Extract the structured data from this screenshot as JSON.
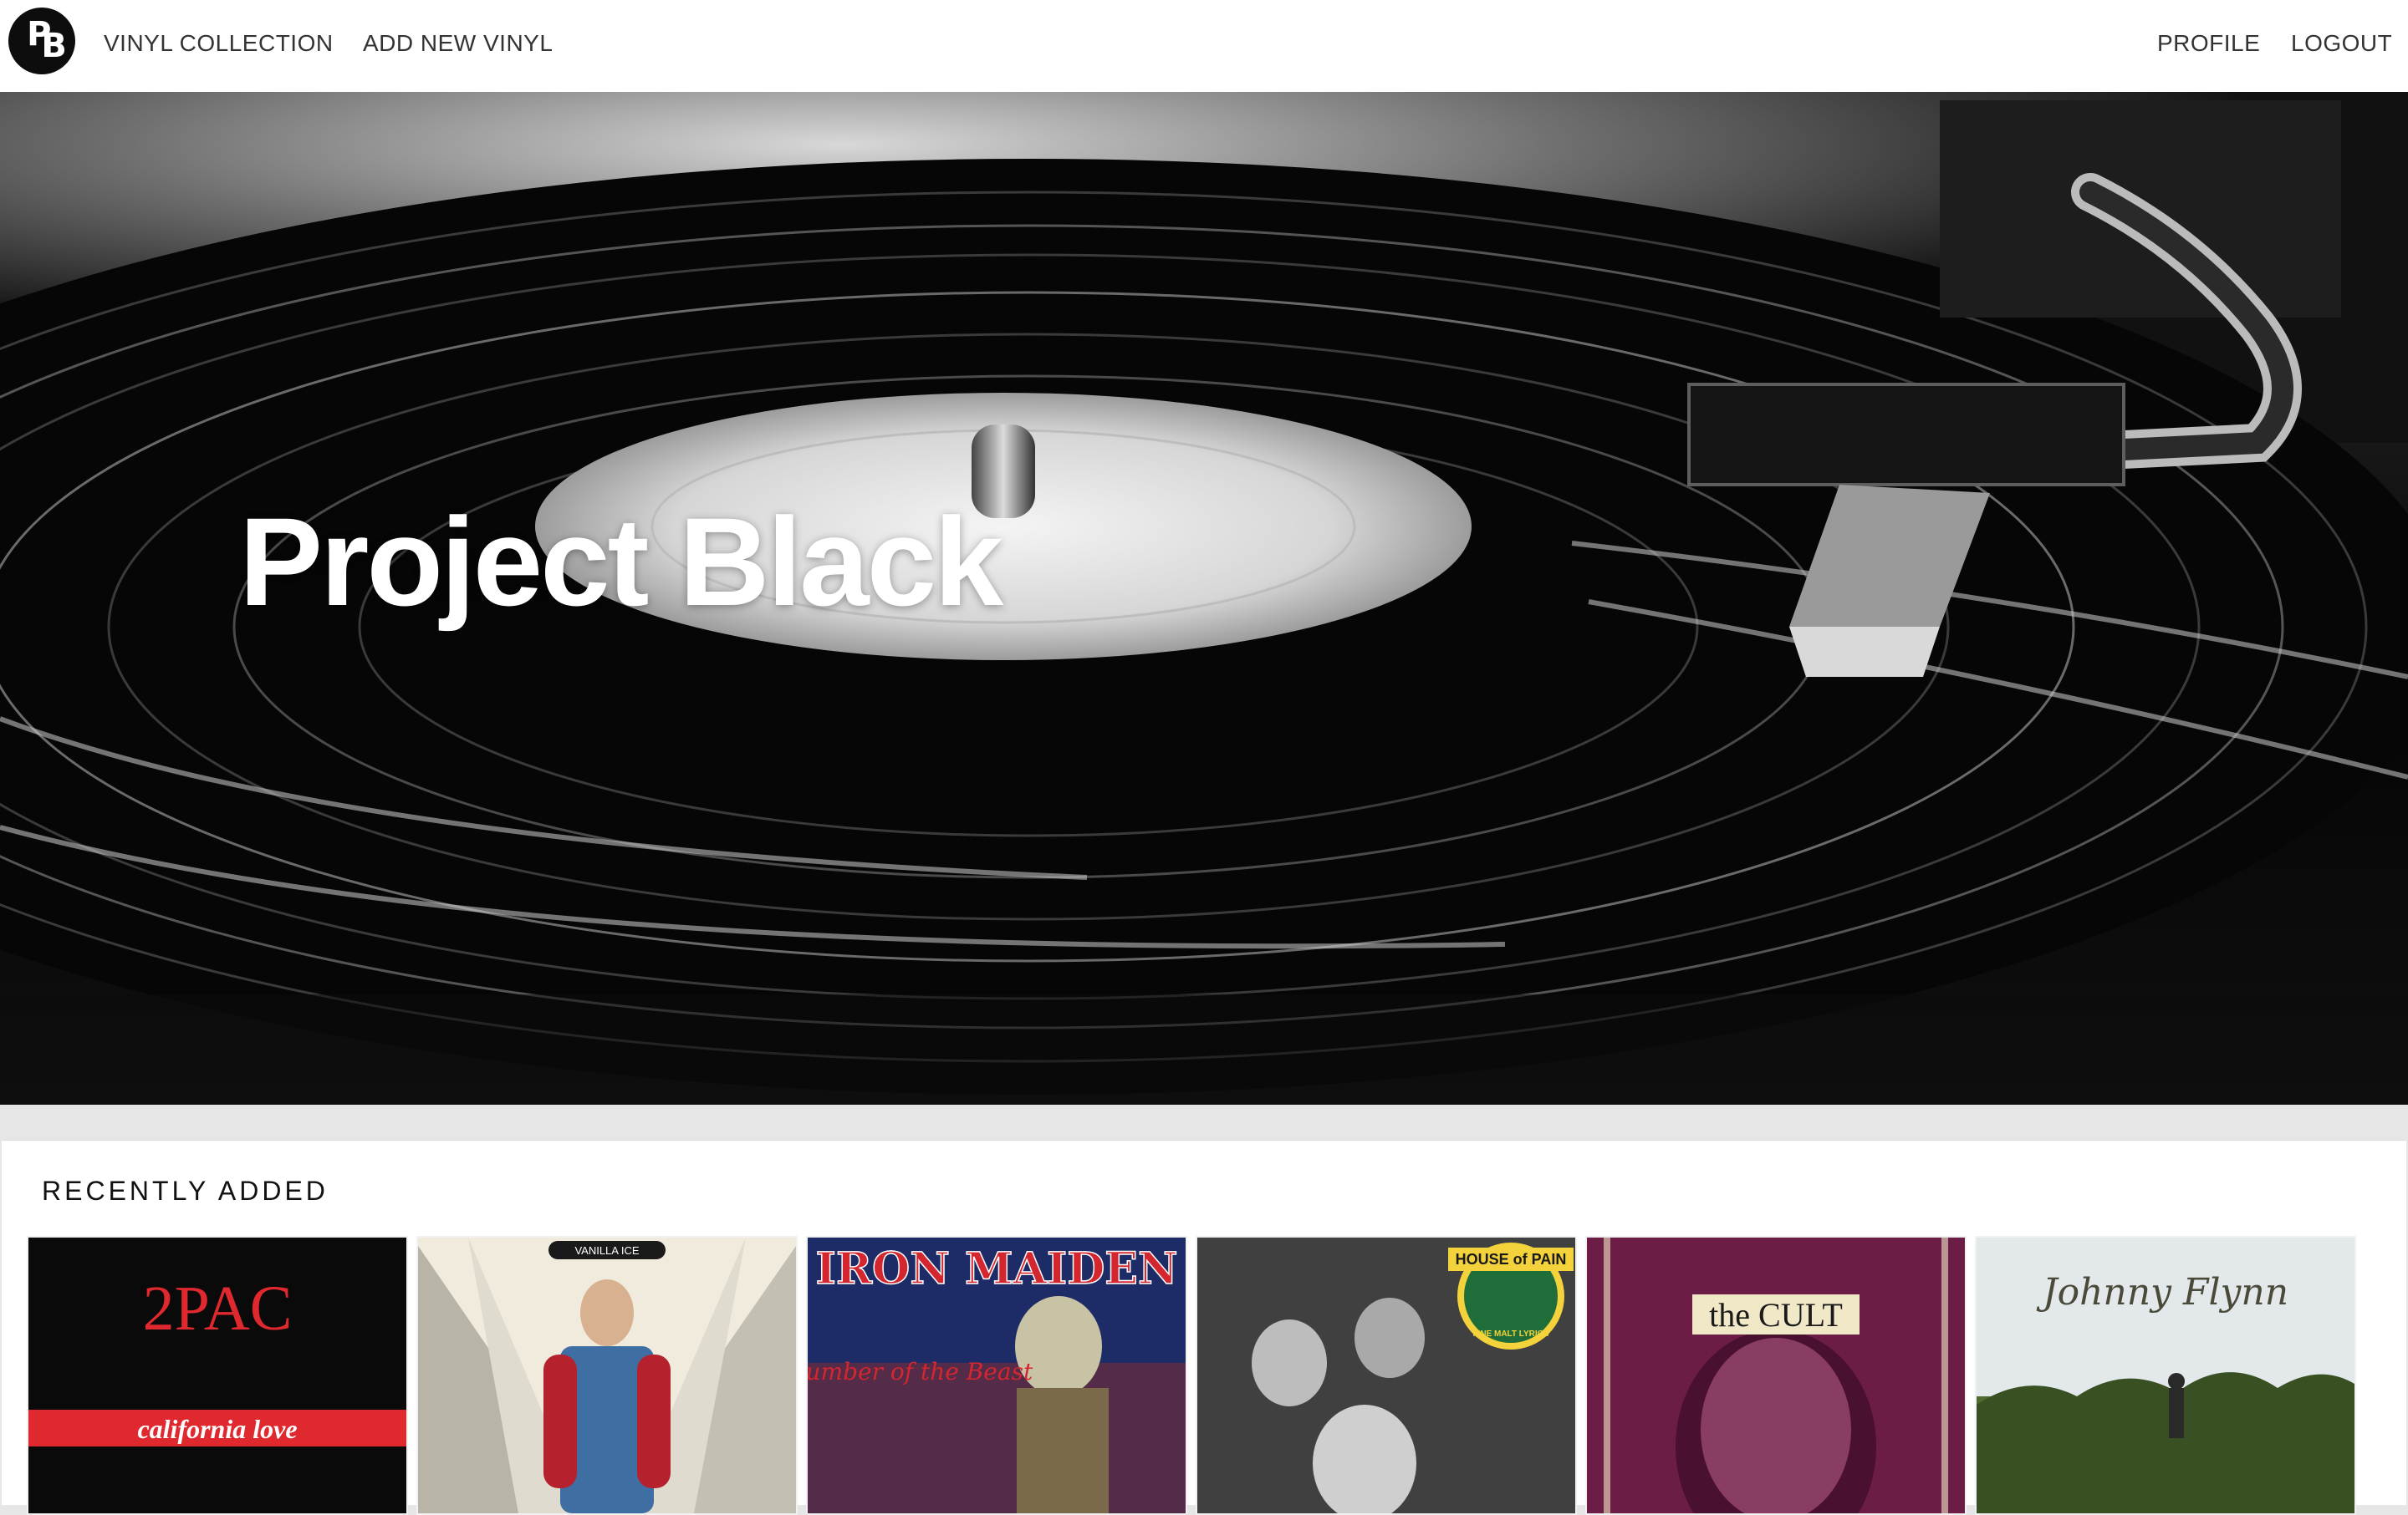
{
  "nav": {
    "logo_text": "PB",
    "links_left": [
      "VINYL COLLECTION",
      "ADD NEW VINYL"
    ],
    "links_right": [
      "PROFILE",
      "LOGOUT"
    ]
  },
  "hero": {
    "title": "Project Black"
  },
  "recent": {
    "heading": "RECENTLY ADDED",
    "albums": [
      {
        "artist": "2PAC",
        "title": "california love",
        "colors": [
          "#0a0a0a",
          "#d62027"
        ]
      },
      {
        "artist": "VANILLA ICE",
        "colors": [
          "#f2ede2",
          "#6e8fb0"
        ]
      },
      {
        "artist": "IRON MAIDEN",
        "title": "The Number of the Beast",
        "colors": [
          "#1c2c6b",
          "#c8102e"
        ]
      },
      {
        "artist": "HOUSE of PAIN",
        "title": "FINE MALT LYRICS",
        "colors": [
          "#3a3a3a",
          "#f4d23c"
        ]
      },
      {
        "artist": "the CULT",
        "colors": [
          "#6b1d45",
          "#f1e8c8"
        ]
      },
      {
        "artist": "Johnny Flynn",
        "colors": [
          "#dfe4e6",
          "#4f6b32"
        ]
      }
    ]
  }
}
